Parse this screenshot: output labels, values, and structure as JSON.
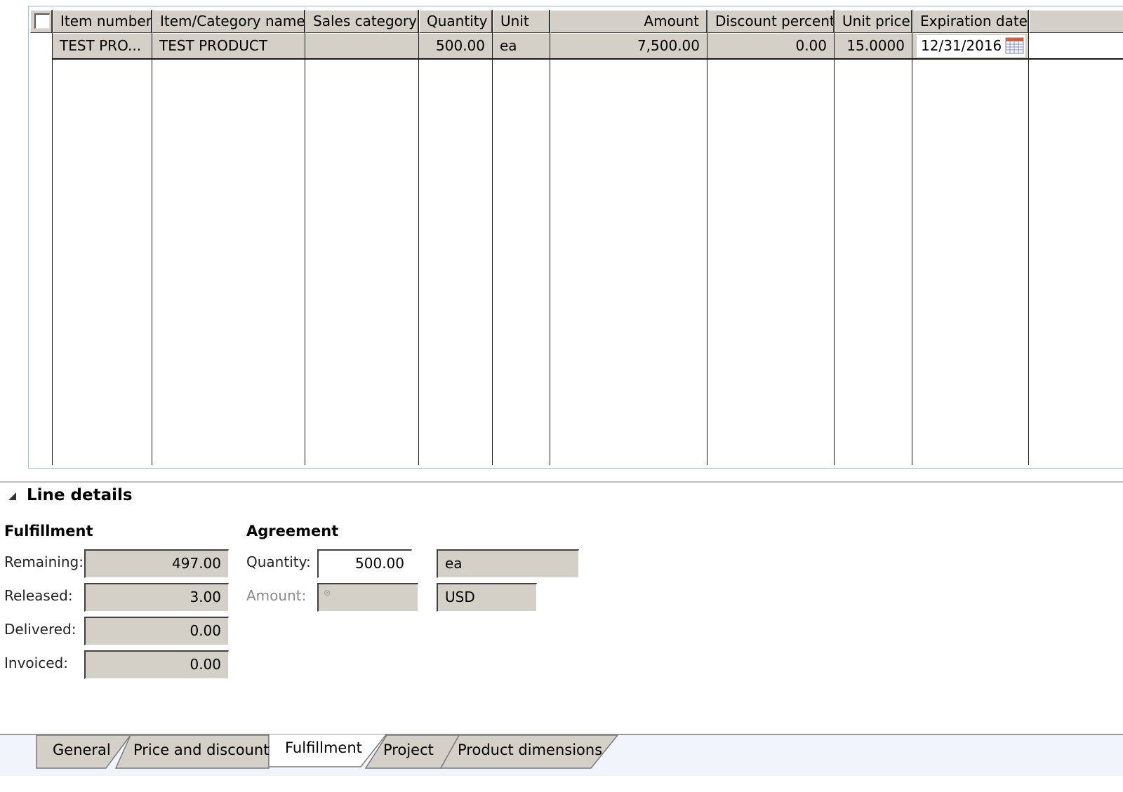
{
  "grid": {
    "columns": [
      {
        "label": "Item number"
      },
      {
        "label": "Item/Category name"
      },
      {
        "label": "Sales category"
      },
      {
        "label": "Quantity"
      },
      {
        "label": "Unit"
      },
      {
        "label": "Amount"
      },
      {
        "label": "Discount percent"
      },
      {
        "label": "Unit price"
      },
      {
        "label": "Expiration date"
      }
    ],
    "rows": [
      {
        "item_number": "TEST PRO...",
        "item_name": "TEST PRODUCT",
        "sales_category": "",
        "quantity": "500.00",
        "unit": "ea",
        "amount": "7,500.00",
        "discount_percent": "0.00",
        "unit_price": "15.0000",
        "expiration_date": "12/31/2016"
      }
    ]
  },
  "line_details": {
    "title": "Line details",
    "fulfillment": {
      "title": "Fulfillment",
      "remaining_label": "Remaining:",
      "remaining_value": "497.00",
      "released_label": "Released:",
      "released_value": "3.00",
      "delivered_label": "Delivered:",
      "delivered_value": "0.00",
      "invoiced_label": "Invoiced:",
      "invoiced_value": "0.00"
    },
    "agreement": {
      "title": "Agreement",
      "quantity_label": "Quantity:",
      "quantity_value": "500.00",
      "quantity_unit": "ea",
      "amount_label": "Amount:",
      "amount_value": "",
      "amount_currency": "USD"
    }
  },
  "tabs": [
    {
      "label": "General",
      "active": false
    },
    {
      "label": "Price and discount",
      "active": false
    },
    {
      "label": "Fulfillment",
      "active": true
    },
    {
      "label": "Project",
      "active": false
    },
    {
      "label": "Product dimensions",
      "active": false
    }
  ],
  "colors": {
    "control_gray": "#d4d0c8",
    "grid_border": "#a9c0da",
    "tabstrip_bg": "#f1f4fb"
  }
}
